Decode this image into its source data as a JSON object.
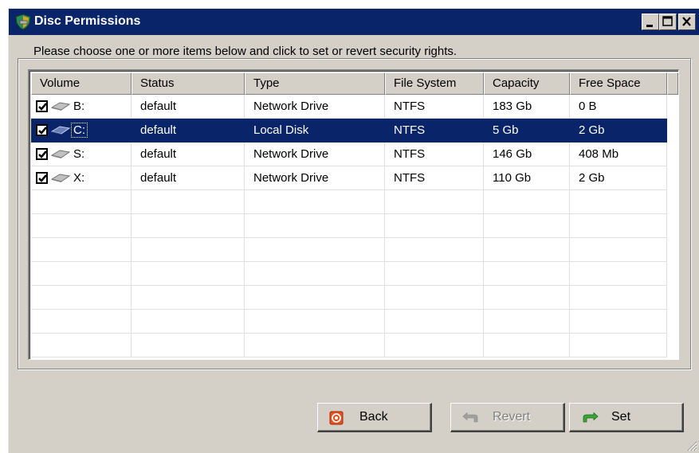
{
  "window": {
    "title": "Disc Permissions",
    "icon": "shield-drive-icon",
    "controls": [
      "minimize-icon",
      "maximize-icon",
      "close-icon"
    ]
  },
  "group": {
    "legend": "Please choose one or more items below and click to set or revert security rights."
  },
  "list": {
    "columns": [
      "Volume",
      "Status",
      "Type",
      "File System",
      "Capacity",
      "Free Space"
    ],
    "rows": [
      {
        "checked": true,
        "icon": "network-drive-icon",
        "volume": "B:",
        "status": "default",
        "type": "Network Drive",
        "fs": "NTFS",
        "capacity": "183 Gb",
        "free": "0 B",
        "selected": false
      },
      {
        "checked": true,
        "icon": "local-disk-icon",
        "volume": "C:",
        "status": "default",
        "type": "Local Disk",
        "fs": "NTFS",
        "capacity": "5 Gb",
        "free": "2 Gb",
        "selected": true
      },
      {
        "checked": true,
        "icon": "network-drive-icon",
        "volume": "S:",
        "status": "default",
        "type": "Network Drive",
        "fs": "NTFS",
        "capacity": "146 Gb",
        "free": "408 Mb",
        "selected": false
      },
      {
        "checked": true,
        "icon": "network-drive-icon",
        "volume": "X:",
        "status": "default",
        "type": "Network Drive",
        "fs": "NTFS",
        "capacity": "110 Gb",
        "free": "2 Gb",
        "selected": false
      }
    ]
  },
  "buttons": {
    "back": {
      "label": "Back",
      "icon": "back-icon",
      "enabled": true
    },
    "revert": {
      "label": "Revert",
      "icon": "revert-icon",
      "enabled": false
    },
    "set": {
      "label": "Set",
      "icon": "set-icon",
      "enabled": true
    }
  },
  "colors": {
    "title_bar": "#0a246a",
    "selection": "#0a246a",
    "face": "#d4d0c8"
  }
}
